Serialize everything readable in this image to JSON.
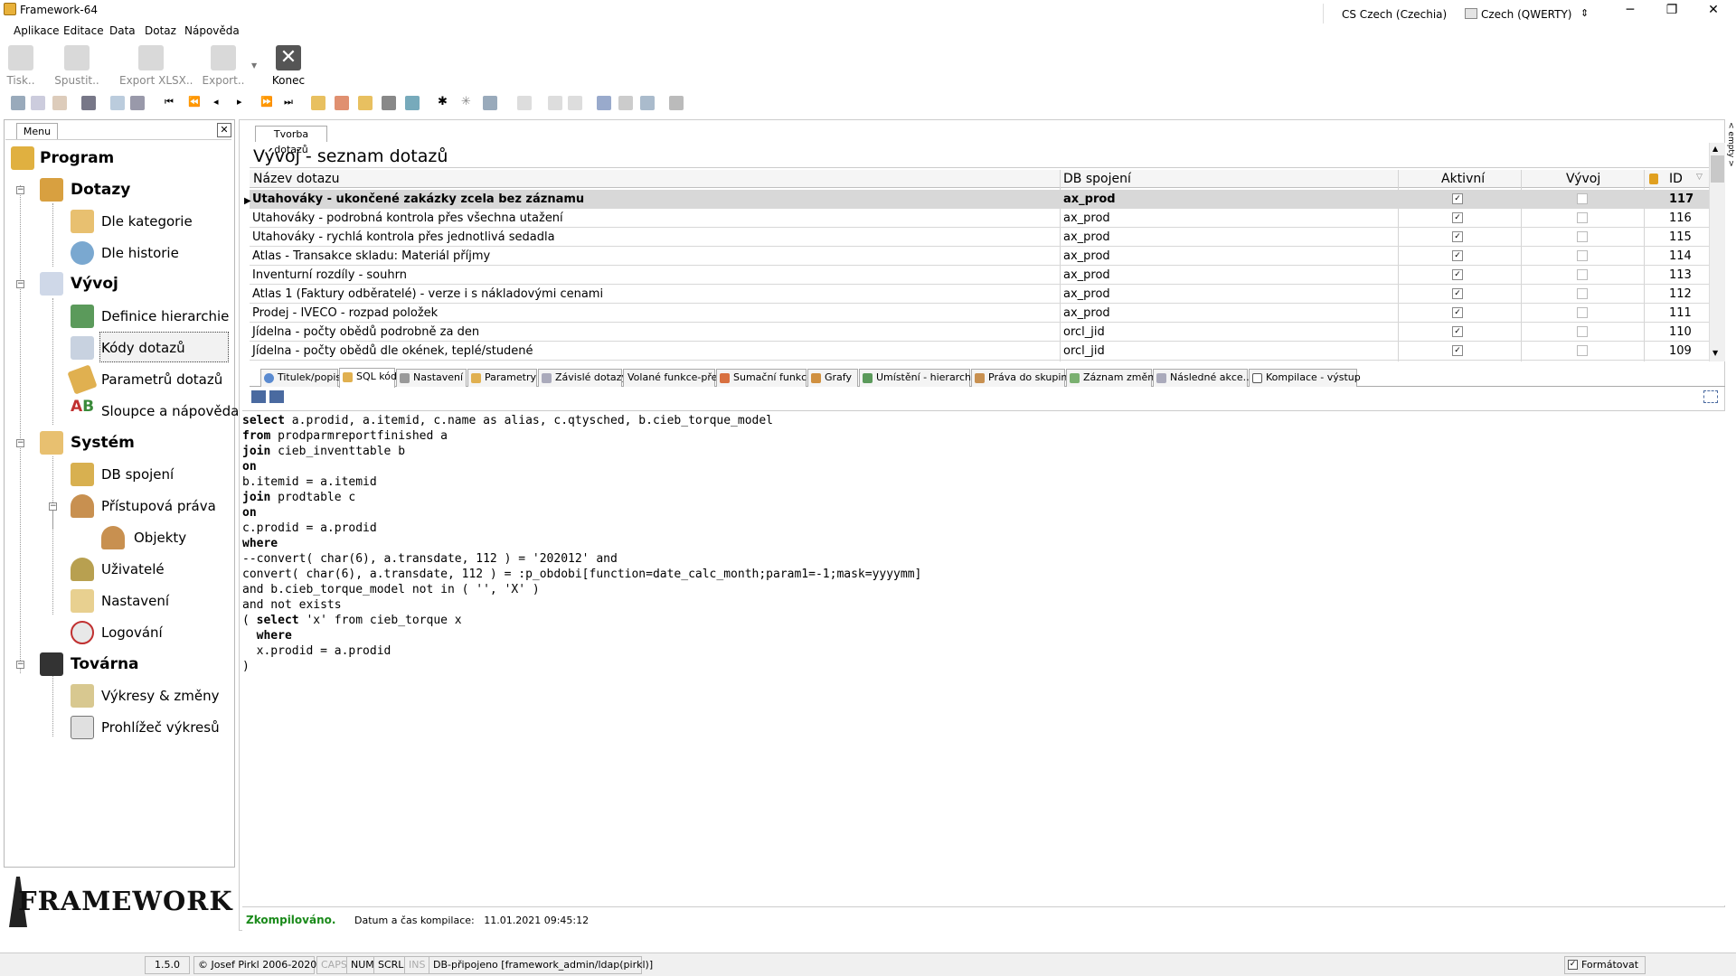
{
  "window": {
    "title": "Framework-64",
    "lang1": "CS Czech (Czechia)",
    "lang2": "Czech (QWERTY)"
  },
  "menubar": [
    "Aplikace",
    "Editace",
    "Data",
    "Dotaz",
    "Nápověda"
  ],
  "toolbar": {
    "print": "Tisk..",
    "run": "Spustit..",
    "export_xlsx": "Export XLSX..",
    "export": "Export..",
    "close": "Konec"
  },
  "menu_panel": {
    "tab": "Menu",
    "tree": {
      "root": "Program",
      "dotazy": "Dotazy",
      "dle_kategorie": "Dle kategorie",
      "dle_historie": "Dle historie",
      "vyvoj": "Vývoj",
      "definice_hierarchie": "Definice hierarchie",
      "kody_dotazu": "Kódy dotazů",
      "parametru_dotazu": "Parametrů dotazů",
      "sloupce_napoveda": "Sloupce a nápověda",
      "system": "Systém",
      "db_spojeni": "DB spojení",
      "pristupova_prava": "Přístupová práva",
      "objekty": "Objekty",
      "uzivatele": "Uživatelé",
      "nastaveni": "Nastavení",
      "logovani": "Logování",
      "tovarna": "Továrna",
      "vykresy": "Výkresy & změny",
      "prohlizec": "Prohlížeč výkresů"
    },
    "logo": "FRAMEWORK 64"
  },
  "document_tab": "Tvorba dotazů",
  "grid": {
    "title": "Vývoj - seznam dotazů",
    "headers": {
      "name": "Název dotazu",
      "db": "DB spojení",
      "active": "Aktivní",
      "dev": "Vývoj",
      "id": "ID"
    },
    "rows": [
      {
        "name": "Utahováky - ukončené zakázky zcela bez záznamu",
        "db": "ax_prod",
        "active": true,
        "dev": false,
        "id": "117"
      },
      {
        "name": "Utahováky - podrobná kontrola přes všechna utažení",
        "db": "ax_prod",
        "active": true,
        "dev": false,
        "id": "116"
      },
      {
        "name": "Utahováky - rychlá kontrola přes jednotlivá sedadla",
        "db": "ax_prod",
        "active": true,
        "dev": false,
        "id": "115"
      },
      {
        "name": "Atlas - Transakce skladu: Materiál příjmy",
        "db": "ax_prod",
        "active": true,
        "dev": false,
        "id": "114"
      },
      {
        "name": "Inventurní rozdíly - souhrn",
        "db": "ax_prod",
        "active": true,
        "dev": false,
        "id": "113"
      },
      {
        "name": "Atlas 1 (Faktury odběratelé) - verze i s nákladovými cenami",
        "db": "ax_prod",
        "active": true,
        "dev": false,
        "id": "112"
      },
      {
        "name": "Prodej - IVECO - rozpad položek",
        "db": "ax_prod",
        "active": true,
        "dev": false,
        "id": "111"
      },
      {
        "name": "Jídelna - počty obědů podrobně za den",
        "db": "orcl_jid",
        "active": true,
        "dev": false,
        "id": "110"
      },
      {
        "name": "Jídelna - počty obědů dle okének, teplé/studené",
        "db": "orcl_jid",
        "active": true,
        "dev": false,
        "id": "109"
      }
    ]
  },
  "tabs": [
    "Titulek/popis",
    "SQL kód",
    "Nastavení",
    "Parametry",
    "Závislé dotazy",
    "Volané funkce-před",
    "Sumační funkce",
    "Grafy",
    "Umístění - hierarchie",
    "Práva do skupin",
    "Záznam změn",
    "Následné akce..",
    "Kompilace - výstup"
  ],
  "sql_lines": [
    "select a.prodid, a.itemid, c.name as alias, c.qtysched, b.cieb_torque_model",
    "from prodparmreportfinished a",
    "join cieb_inventtable b",
    "on",
    "b.itemid = a.itemid",
    "join prodtable c",
    "on",
    "c.prodid = a.prodid",
    "where",
    "--convert( char(6), a.transdate, 112 ) = '202012' and",
    "convert( char(6), a.transdate, 112 ) = :p_obdobi[function=date_calc_month;param1=-1;mask=yyyymm]",
    "and b.cieb_torque_model not in ( '', 'X' )",
    "and not exists",
    "( select 'x' from cieb_torque x",
    "  where",
    "  x.prodid = a.prodid",
    ")"
  ],
  "compile": {
    "status": "Zkompilováno.",
    "date_label": "Datum a čas kompilace:",
    "date": "11.01.2021 09:45:12"
  },
  "statusbar": {
    "version": "1.5.0",
    "copyright": "© Josef Pirkl 2006-2020",
    "caps": "CAPS",
    "num": "NUM",
    "scrl": "SCRL",
    "ins": "INS",
    "db": "DB-připojeno [framework_admin/ldap(pirkl)]",
    "format": "Formátovat"
  },
  "side_label": "< empty >"
}
